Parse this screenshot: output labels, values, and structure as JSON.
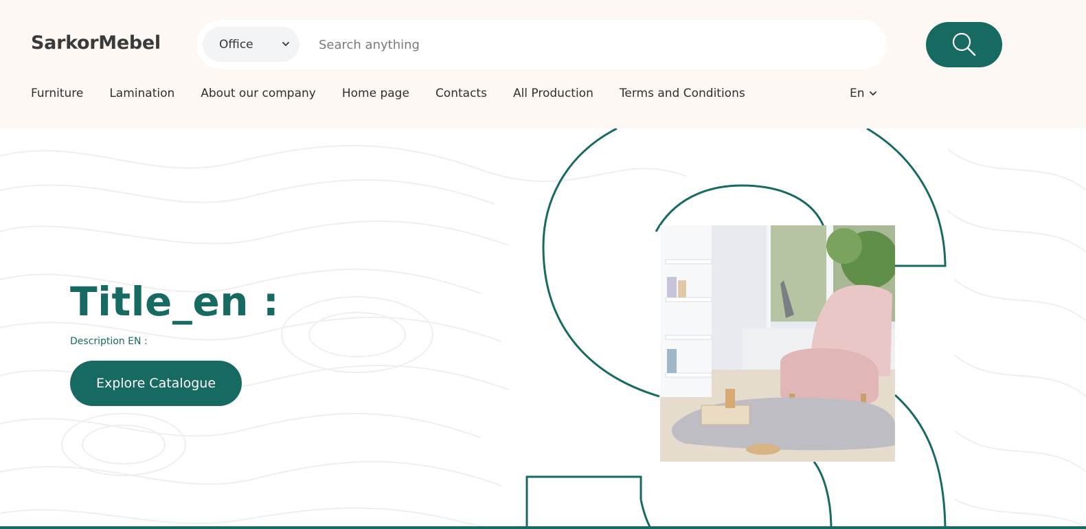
{
  "brand": {
    "logo": "SarkorMebel"
  },
  "search": {
    "category": "Office",
    "placeholder": "Search anything",
    "value": ""
  },
  "nav": {
    "items": [
      {
        "label": "Furniture"
      },
      {
        "label": "Lamination"
      },
      {
        "label": "About our company"
      },
      {
        "label": "Home page"
      },
      {
        "label": "Contacts"
      },
      {
        "label": "All Production"
      },
      {
        "label": "Terms and Conditions"
      }
    ],
    "language": "En"
  },
  "hero": {
    "title": "Title_en :",
    "description": "Description EN :",
    "cta_label": "Explore Catalogue"
  },
  "icons": {
    "search": "search-icon",
    "chevron": "chevron-down-icon"
  },
  "colors": {
    "accent": "#176a61",
    "header_bg": "#fdf8f3",
    "page_bg": "#ffffff",
    "text": "#2f2f2f"
  }
}
